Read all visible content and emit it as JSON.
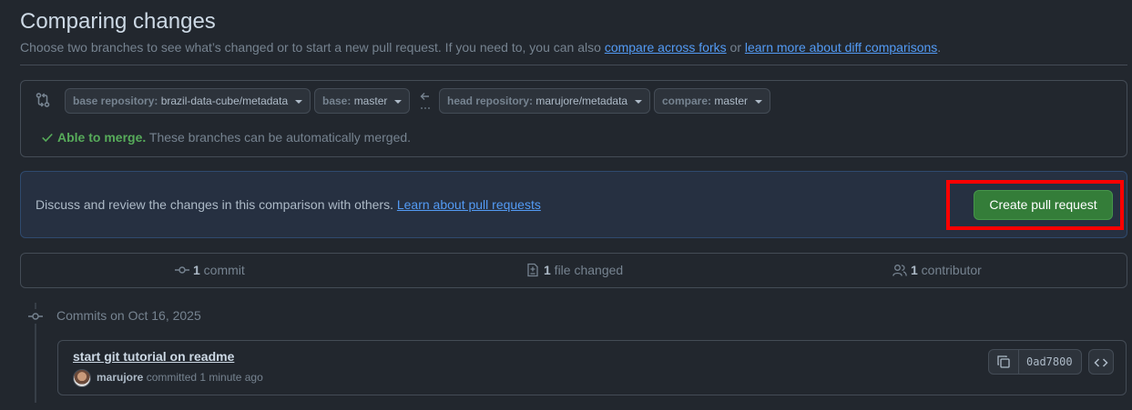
{
  "header": {
    "title": "Comparing changes",
    "subtitle_prefix": "Choose two branches to see what’s changed or to start a new pull request. If you need to, you can also ",
    "link_forks": "compare across forks",
    "subtitle_or": " or ",
    "link_diff": "learn more about diff comparisons",
    "subtitle_suffix": "."
  },
  "compare": {
    "base_repo_label": "base repository: ",
    "base_repo_value": "brazil-data-cube/metadata",
    "base_label": "base: ",
    "base_value": "master",
    "head_repo_label": "head repository: ",
    "head_repo_value": "marujore/metadata",
    "compare_label": "compare: ",
    "compare_value": "master",
    "merge_ok": "Able to merge.",
    "merge_text": " These branches can be automatically merged."
  },
  "pr_banner": {
    "text": "Discuss and review the changes in this comparison with others. ",
    "link": "Learn about pull requests",
    "button": "Create pull request"
  },
  "stats": {
    "commits_count": "1",
    "commits_label": " commit",
    "files_count": "1",
    "files_label": " file changed",
    "contributors_count": "1",
    "contributors_label": " contributor"
  },
  "timeline": {
    "date_header": "Commits on Oct 16, 2025",
    "commit": {
      "title": "start git tutorial on readme",
      "author": "marujore",
      "meta": " committed 1 minute ago",
      "sha": "0ad7800"
    }
  },
  "colors": {
    "accent_link": "#539bf5",
    "success": "#57ab5a",
    "button_green": "#347d39",
    "highlight_red": "#ff0000"
  }
}
